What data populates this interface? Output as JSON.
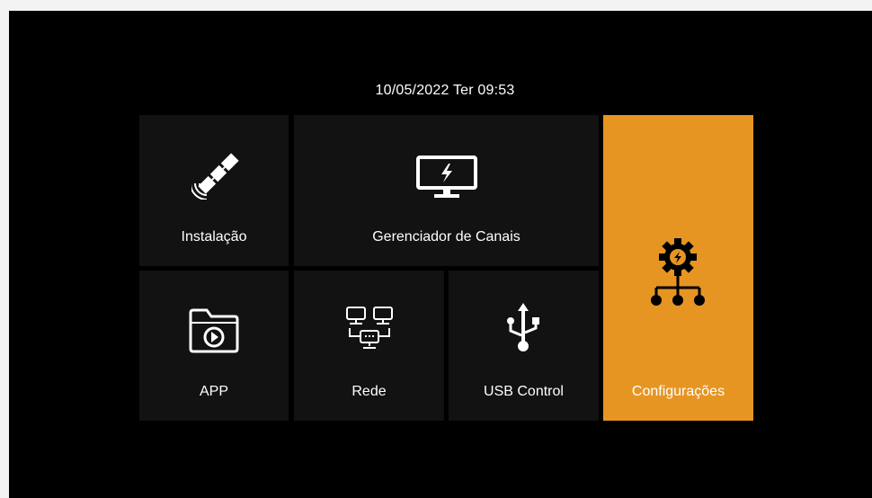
{
  "header": {
    "datetime": "10/05/2022 Ter 09:53"
  },
  "menu": {
    "installation": {
      "label": "Instalação",
      "icon": "satellite-icon"
    },
    "channel_manager": {
      "label": "Gerenciador de Canais",
      "icon": "tv-monitor-icon"
    },
    "settings": {
      "label": "Configurações",
      "icon": "gear-network-icon",
      "selected": true
    },
    "app": {
      "label": "APP",
      "icon": "app-folder-play-icon"
    },
    "network": {
      "label": "Rede",
      "icon": "network-computers-icon"
    },
    "usb": {
      "label": "USB Control",
      "icon": "usb-icon"
    }
  },
  "colors": {
    "background": "#000000",
    "tile": "#121212",
    "selected": "#e69523",
    "text": "#ffffff"
  }
}
